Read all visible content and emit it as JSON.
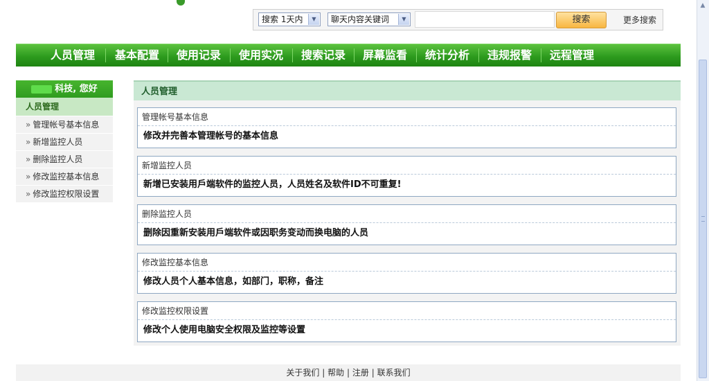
{
  "search": {
    "time_select": "搜索 1天内",
    "type_select": "聊天内容关键词",
    "keyword_value": "",
    "button": "搜索",
    "more": "更多搜索"
  },
  "nav": {
    "items": [
      "人员管理",
      "基本配置",
      "使用记录",
      "使用实况",
      "搜索记录",
      "屏幕监看",
      "统计分析",
      "违规报警",
      "远程管理"
    ]
  },
  "sidebar": {
    "greeting": "科技, 您好",
    "category": "人员管理",
    "items": [
      "管理帐号基本信息",
      "新增监控人员",
      "删除监控人员",
      "修改监控基本信息",
      "修改监控权限设置"
    ]
  },
  "main": {
    "title": "人员管理",
    "cards": [
      {
        "title": "管理帐号基本信息",
        "desc": "修改并完善本管理帐号的基本信息"
      },
      {
        "title": "新增监控人员",
        "desc": "新增已安装用戶端软件的监控人员，人员姓名及软件ID不可重复!"
      },
      {
        "title": "删除监控人员",
        "desc": "删除因重新安装用戶端软件或因职务变动而换电脑的人员"
      },
      {
        "title": "修改监控基本信息",
        "desc": "修改人员个人基本信息，如部门，职称，备注"
      },
      {
        "title": "修改监控权限设置",
        "desc": "修改个人使用电脑安全权限及监控等设置"
      }
    ]
  },
  "footer": {
    "links": [
      "关于我们",
      "帮助",
      "注册",
      "联系我们"
    ],
    "separator": "|"
  },
  "colors": {
    "nav_green": "#2d9b1e",
    "side_green": "#3aa926",
    "header_mint": "#c9e8d3",
    "card_border": "#8ea7c2",
    "button_orange": "#f8b640"
  }
}
